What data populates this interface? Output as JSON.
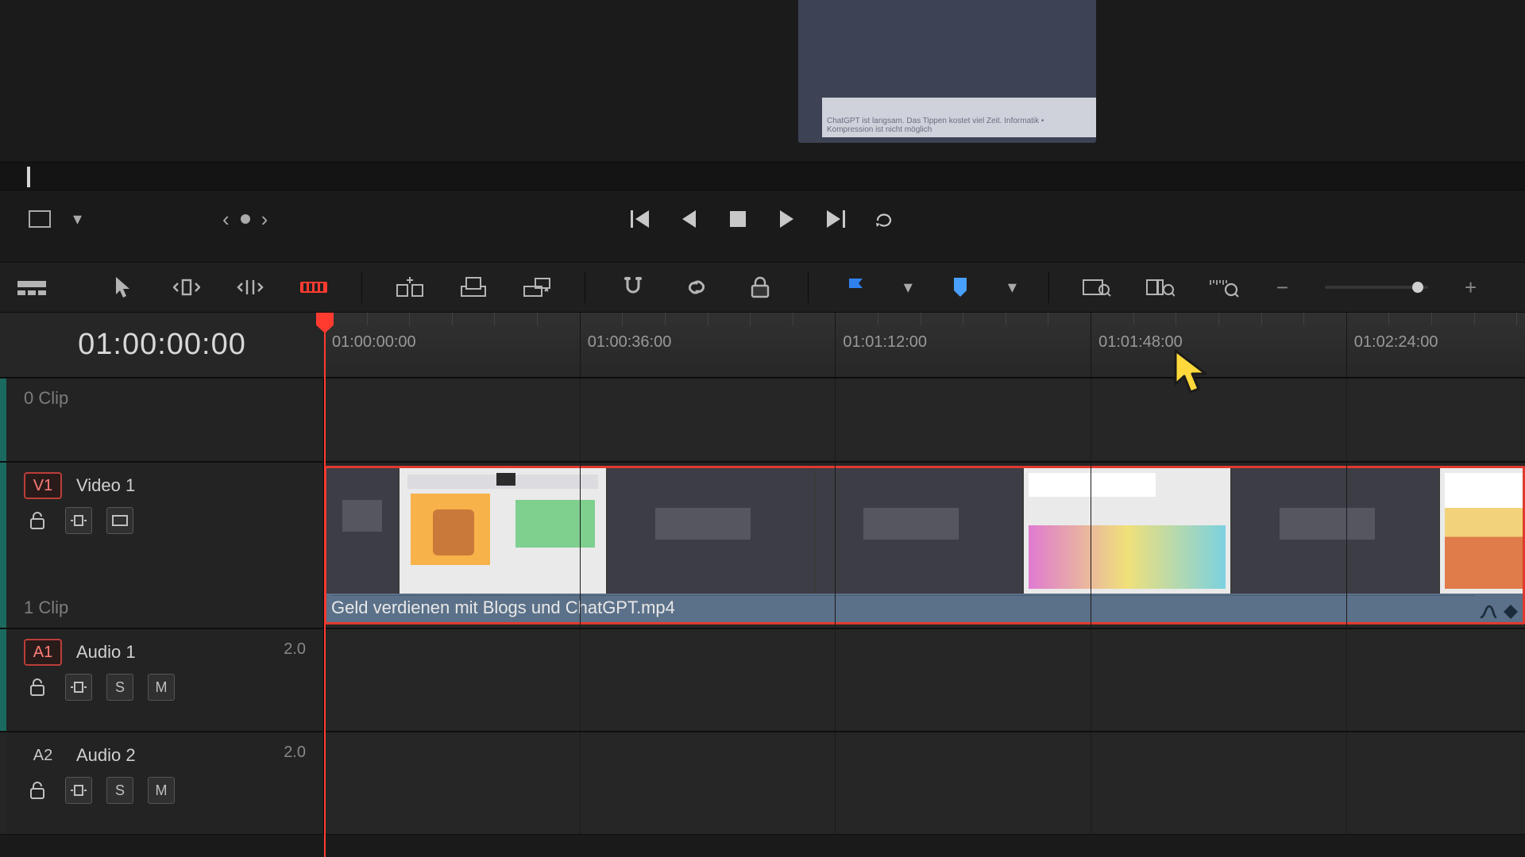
{
  "preview": {
    "caption": "ChatGPT ist langsam. Das Tippen kostet viel Zeit. Informatik • Kompression ist nicht möglich"
  },
  "transport": {
    "prev_label": "Previous",
    "next_label": "Next"
  },
  "timecode": "01:00:00:00",
  "ruler": {
    "ticks": [
      "01:00:00:00",
      "01:00:36:00",
      "01:01:12:00",
      "01:01:48:00",
      "01:02:24:00"
    ]
  },
  "bus_row": {
    "count_label": "0 Clip"
  },
  "video_track": {
    "tag": "V1",
    "name": "Video 1",
    "count": "1 Clip",
    "clip_name": "Geld verdienen mit Blogs und ChatGPT.mp4"
  },
  "audio1": {
    "tag": "A1",
    "name": "Audio 1",
    "channels": "2.0"
  },
  "audio2": {
    "tag": "A2",
    "name": "Audio 2",
    "channels": "2.0"
  },
  "colors": {
    "accent_red": "#ff3b30",
    "flag_blue": "#2f80ed",
    "track_green": "#1b6a5f"
  }
}
